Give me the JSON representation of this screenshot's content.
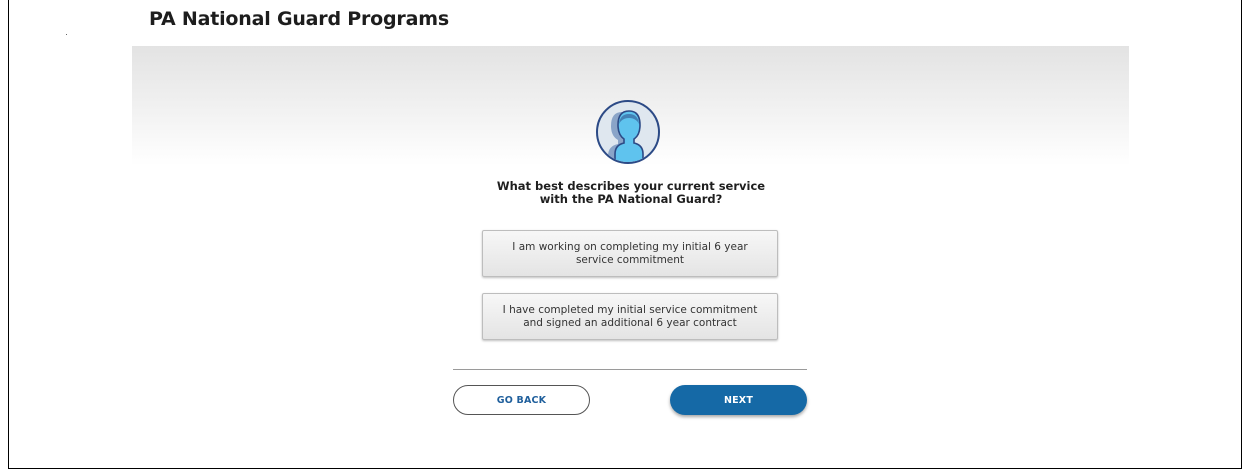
{
  "page": {
    "title": "PA National Guard Programs"
  },
  "question": {
    "line1": "What best describes your current service",
    "line2": "with the PA National Guard?"
  },
  "options": [
    {
      "line1": "I am working on completing my initial 6 year",
      "line2": "service commitment"
    },
    {
      "line1": "I have completed my initial service commitment",
      "line2": "and signed an additional 6 year contract"
    }
  ],
  "buttons": {
    "back_label": "GO BACK",
    "next_label": "NEXT"
  },
  "colors": {
    "accent": "#1569a6",
    "avatar_fill": "#5fc3ee",
    "avatar_ring": "#2c4a86"
  },
  "icons": {
    "avatar": "user-avatar-icon"
  }
}
